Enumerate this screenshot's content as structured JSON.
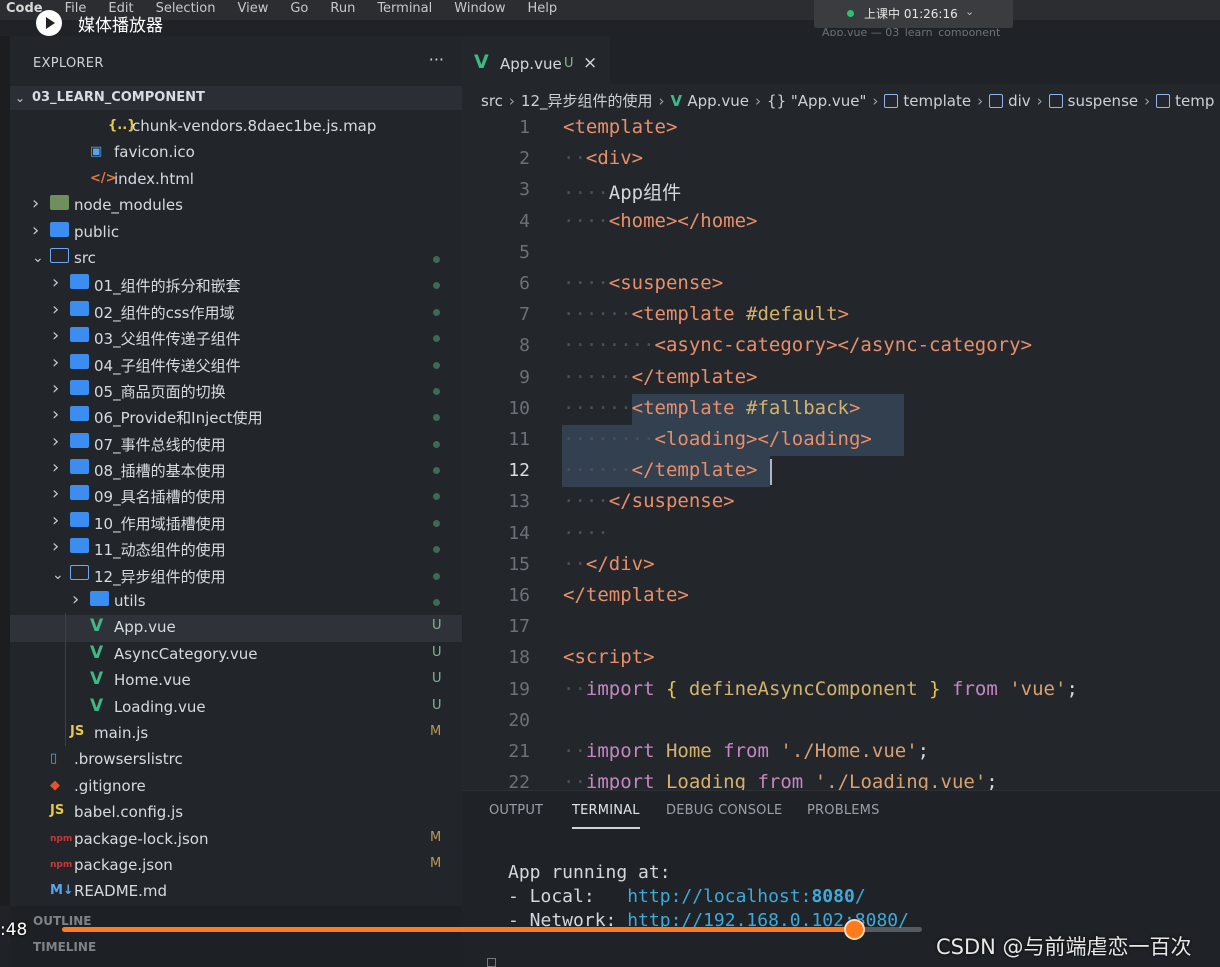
{
  "menubar": {
    "items": [
      "Code",
      "File",
      "Edit",
      "Selection",
      "View",
      "Go",
      "Run",
      "Terminal",
      "Window",
      "Help"
    ]
  },
  "window_title": "App.vue — 03_learn_component",
  "live_status": {
    "text": "上课中 01:26:16",
    "color": "#2fbf71"
  },
  "player": {
    "title": "媒体播放器",
    "time": ":48",
    "progress_fraction": 0.9209,
    "accent": "#ff7a1a"
  },
  "watermark": "CSDN @与前端虐恋一百次",
  "explorer": {
    "title": "EXPLORER",
    "more": "···",
    "project": "03_LEARN_COMPONENT",
    "items": [
      {
        "label": "chunk-vendors.8daec1be.js.map",
        "indent": 3,
        "icon": "json-icon",
        "chev": ""
      },
      {
        "label": "favicon.ico",
        "indent": 2,
        "icon": "image-icon",
        "chev": ""
      },
      {
        "label": "index.html",
        "indent": 2,
        "icon": "html-icon",
        "chev": ""
      },
      {
        "label": "node_modules",
        "indent": 0,
        "icon": "folder-node-icon",
        "chev": "closed"
      },
      {
        "label": "public",
        "indent": 0,
        "icon": "folder-icon",
        "chev": "closed"
      },
      {
        "label": "src",
        "indent": 0,
        "icon": "folder-open-icon",
        "chev": "open",
        "dot": true
      },
      {
        "label": "01_组件的拆分和嵌套",
        "indent": 1,
        "icon": "folder-icon",
        "chev": "closed",
        "dot": true
      },
      {
        "label": "02_组件的css作用域",
        "indent": 1,
        "icon": "folder-icon",
        "chev": "closed",
        "dot": true
      },
      {
        "label": "03_父组件传递子组件",
        "indent": 1,
        "icon": "folder-icon",
        "chev": "closed",
        "dot": true
      },
      {
        "label": "04_子组件传递父组件",
        "indent": 1,
        "icon": "folder-icon",
        "chev": "closed",
        "dot": true
      },
      {
        "label": "05_商品页面的切换",
        "indent": 1,
        "icon": "folder-icon",
        "chev": "closed",
        "dot": true
      },
      {
        "label": "06_Provide和Inject使用",
        "indent": 1,
        "icon": "folder-icon",
        "chev": "closed",
        "dot": true
      },
      {
        "label": "07_事件总线的使用",
        "indent": 1,
        "icon": "folder-icon",
        "chev": "closed",
        "dot": true
      },
      {
        "label": "08_插槽的基本使用",
        "indent": 1,
        "icon": "folder-icon",
        "chev": "closed",
        "dot": true
      },
      {
        "label": "09_具名插槽的使用",
        "indent": 1,
        "icon": "folder-icon",
        "chev": "closed",
        "dot": true
      },
      {
        "label": "10_作用域插槽使用",
        "indent": 1,
        "icon": "folder-icon",
        "chev": "closed",
        "dot": true
      },
      {
        "label": "11_动态组件的使用",
        "indent": 1,
        "icon": "folder-icon",
        "chev": "closed",
        "dot": true
      },
      {
        "label": "12_异步组件的使用",
        "indent": 1,
        "icon": "folder-open-icon",
        "chev": "open",
        "dot": true
      },
      {
        "label": "utils",
        "indent": 2,
        "icon": "folder-icon",
        "chev": "closed",
        "dot": true
      },
      {
        "label": "App.vue",
        "indent": 2,
        "icon": "vue-icon",
        "chev": "",
        "badge": "U",
        "selected": true
      },
      {
        "label": "AsyncCategory.vue",
        "indent": 2,
        "icon": "vue-icon",
        "chev": "",
        "badge": "U"
      },
      {
        "label": "Home.vue",
        "indent": 2,
        "icon": "vue-icon",
        "chev": "",
        "badge": "U"
      },
      {
        "label": "Loading.vue",
        "indent": 2,
        "icon": "vue-icon",
        "chev": "",
        "badge": "U"
      },
      {
        "label": "main.js",
        "indent": 1,
        "icon": "js-icon",
        "chev": "",
        "badge": "M"
      },
      {
        "label": ".browserslistrc",
        "indent": 0,
        "icon": "file-icon",
        "chev": ""
      },
      {
        "label": ".gitignore",
        "indent": 0,
        "icon": "git-icon",
        "chev": ""
      },
      {
        "label": "babel.config.js",
        "indent": 0,
        "icon": "js-icon",
        "chev": ""
      },
      {
        "label": "package-lock.json",
        "indent": 0,
        "icon": "npm-icon",
        "chev": "",
        "badge": "M"
      },
      {
        "label": "package.json",
        "indent": 0,
        "icon": "npm-icon",
        "chev": "",
        "badge": "M"
      },
      {
        "label": "README.md",
        "indent": 0,
        "icon": "markdown-icon",
        "chev": ""
      }
    ],
    "outline": "OUTLINE",
    "timeline": "TIMELINE"
  },
  "tab": {
    "name": "App.vue",
    "badge": "U",
    "close": "×"
  },
  "breadcrumb": [
    "src",
    "12_异步组件的使用",
    "App.vue",
    "{} \"App.vue\"",
    "template",
    "div",
    "suspense",
    "temp"
  ],
  "editor": {
    "current_line": 12,
    "lines": [
      {
        "n": "1",
        "html": "<span class='tg'>&lt;template&gt;</span>"
      },
      {
        "n": "2",
        "html": "<span class='dt'>··</span><span class='tg'>&lt;div&gt;</span>"
      },
      {
        "n": "3",
        "html": "<span class='dt'>····</span><span class='pl'>App组件</span>"
      },
      {
        "n": "4",
        "html": "<span class='dt'>····</span><span class='tg'>&lt;home&gt;&lt;/home&gt;</span>"
      },
      {
        "n": "5",
        "html": ""
      },
      {
        "n": "6",
        "html": "<span class='dt'>····</span><span class='tg'>&lt;suspense&gt;</span>"
      },
      {
        "n": "7",
        "html": "<span class='dt'>······</span><span class='tg'>&lt;template </span><span class='at'>#default</span><span class='tg'>&gt;</span>"
      },
      {
        "n": "8",
        "html": "<span class='dt'>········</span><span class='tg'>&lt;async-category&gt;&lt;/async-category&gt;</span>"
      },
      {
        "n": "9",
        "html": "<span class='dt'>······</span><span class='tg'>&lt;/template&gt;</span>"
      },
      {
        "n": "10",
        "html": "<span class='dt'>······</span><span class='tg'>&lt;template </span><span class='at'>#fallback</span><span class='tg'>&gt;</span>"
      },
      {
        "n": "11",
        "html": "<span class='dt'>········</span><span class='tg'>&lt;loading&gt;&lt;/loading&gt;</span>"
      },
      {
        "n": "12",
        "html": "<span class='dt'>······</span><span class='tg'>&lt;/template&gt;</span>"
      },
      {
        "n": "13",
        "html": "<span class='dt'>····</span><span class='tg'>&lt;/suspense&gt;</span>"
      },
      {
        "n": "14",
        "html": "<span class='dt'>····</span>"
      },
      {
        "n": "15",
        "html": "<span class='dt'>··</span><span class='tg'>&lt;/div&gt;</span>"
      },
      {
        "n": "16",
        "html": "<span class='tg'>&lt;/template&gt;</span>"
      },
      {
        "n": "17",
        "html": ""
      },
      {
        "n": "18",
        "html": "<span class='tg'>&lt;script&gt;</span>"
      },
      {
        "n": "19",
        "html": "<span class='dt'>··</span><span class='kw'>import</span><span class='pl'> </span><span class='br'>{</span><span class='fn'> defineAsyncComponent </span><span class='br'>}</span><span class='pl'> </span><span class='kw'>from</span><span class='pl'> </span><span class='str'>'vue'</span><span class='pl'>;</span>"
      },
      {
        "n": "20",
        "html": ""
      },
      {
        "n": "21",
        "html": "<span class='dt'>··</span><span class='kw'>import</span><span class='fn'> Home </span><span class='kw'>from</span><span class='pl'> </span><span class='str'>'./Home.vue'</span><span class='pl'>;</span>"
      },
      {
        "n": "22",
        "html": "<span class='dt'>··</span><span class='kw'>import</span><span class='fn'> Loading </span><span class='kw'>from</span><span class='pl'> </span><span class='str'>'./Loading.vue'</span><span class='pl'>;</span>"
      }
    ]
  },
  "panel": {
    "tabs": [
      "OUTPUT",
      "TERMINAL",
      "DEBUG CONSOLE",
      "PROBLEMS"
    ],
    "active": "TERMINAL",
    "terminal": {
      "line1": "App running at:",
      "local_label": "- Local:   ",
      "local_url": "http://localhost:",
      "local_port": "8080",
      "local_slash": "/",
      "network_label": "- Network: ",
      "network_url": "http://192.168.0.102:8080/"
    }
  }
}
